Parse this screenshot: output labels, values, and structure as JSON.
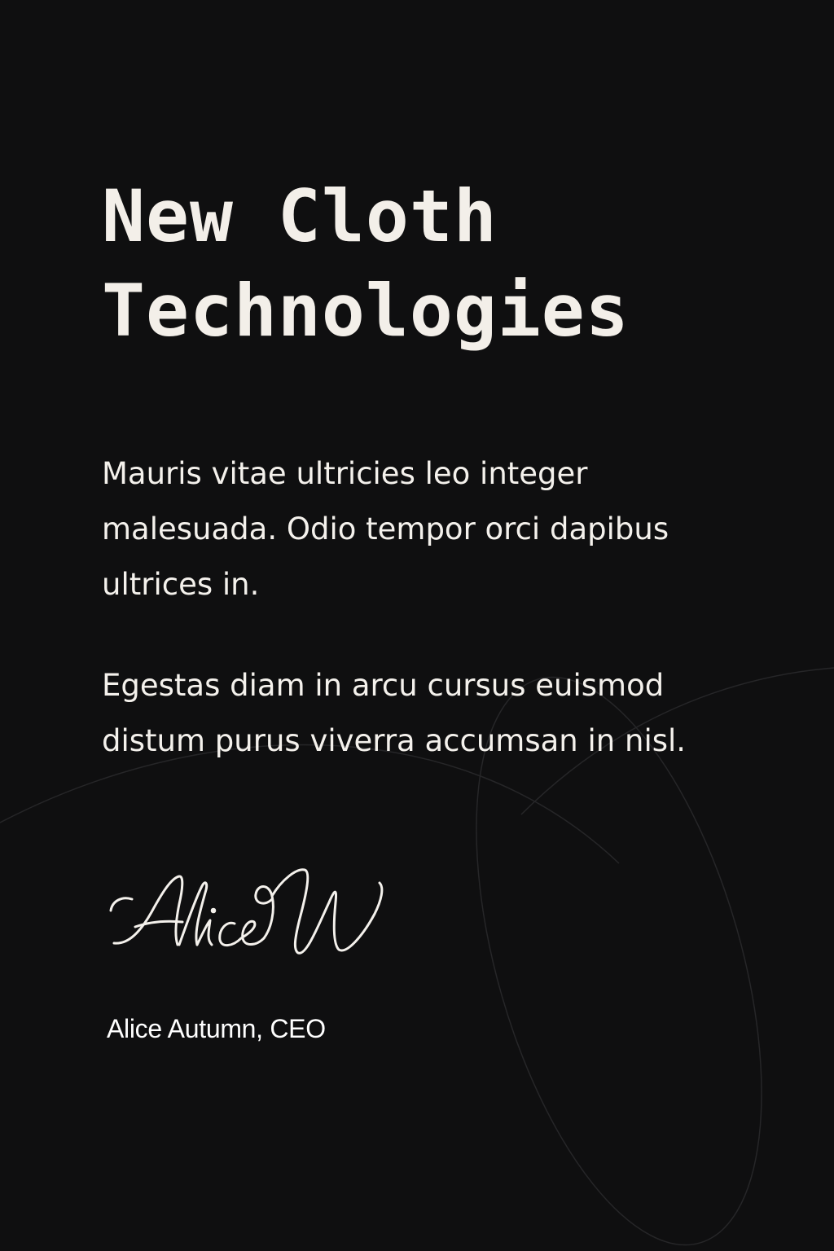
{
  "document": {
    "title_line_1": "New Cloth",
    "title_line_2": "Technologies",
    "paragraph_1": "Mauris vitae ultricies leo integer malesuada. Odio tempor orci dapibus ultrices in.",
    "paragraph_2": "Egestas diam in arcu cursus euismod distum purus viverra accumsan in nisl.",
    "signature_text": "AliceW",
    "signatory": "Alice Autumn, CEO"
  },
  "colors": {
    "background": "#0f0f10",
    "text": "#f4f1ec",
    "decorative_line": "#2a2a2c"
  }
}
